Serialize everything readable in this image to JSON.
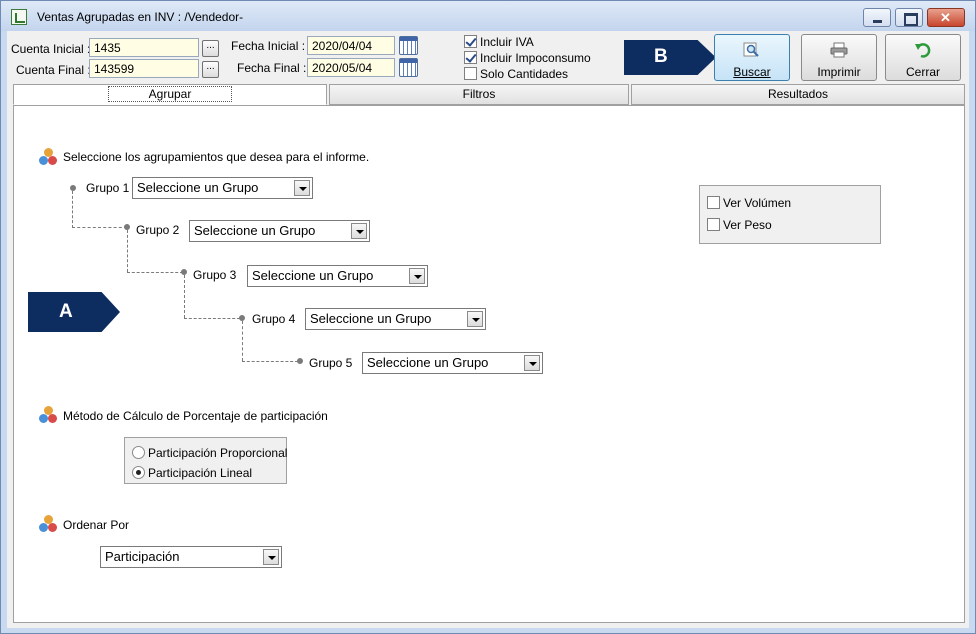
{
  "window": {
    "title": "Ventas Agrupadas en INV :  /Vendedor-"
  },
  "filters": {
    "cuenta_inicial_label": "Cuenta Inicial :",
    "cuenta_inicial_value": "1435",
    "cuenta_final_label": "Cuenta Final :",
    "cuenta_final_value": "143599",
    "fecha_inicial_label": "Fecha Inicial :",
    "fecha_inicial_value": "2020/04/04",
    "fecha_final_label": "Fecha Final :",
    "fecha_final_value": "2020/05/04",
    "dots_label": "...",
    "options": [
      {
        "label": "Incluir IVA",
        "checked": true
      },
      {
        "label": "Incluir Impoconsumo",
        "checked": true
      },
      {
        "label": "Solo Cantidades",
        "checked": false
      }
    ]
  },
  "toolbar": {
    "buscar_label": "Buscar",
    "imprimir_label": "Imprimir",
    "cerrar_label": "Cerrar"
  },
  "annotations": {
    "a": "A",
    "b": "B"
  },
  "tabs": [
    {
      "label": "Agrupar",
      "selected": true
    },
    {
      "label": "Filtros",
      "selected": false
    },
    {
      "label": "Resultados",
      "selected": false
    }
  ],
  "agrupar": {
    "intro": "Seleccione los agrupamientos que desea para el informe.",
    "groups": [
      {
        "label": "Grupo 1",
        "value": "Seleccione un Grupo"
      },
      {
        "label": "Grupo 2",
        "value": "Seleccione un Grupo"
      },
      {
        "label": "Grupo 3",
        "value": "Seleccione un Grupo"
      },
      {
        "label": "Grupo 4",
        "value": "Seleccione un Grupo"
      },
      {
        "label": "Grupo 5",
        "value": "Seleccione un Grupo"
      }
    ],
    "ver": [
      {
        "label": "Ver Volúmen",
        "checked": false
      },
      {
        "label": "Ver Peso",
        "checked": false
      }
    ],
    "metodo_title": "Método de Cálculo de Porcentaje de participación",
    "metodo_options": [
      {
        "label": "Participación Proporcional",
        "selected": false
      },
      {
        "label": "Participación Lineal",
        "selected": true
      }
    ],
    "ordenar_title": "Ordenar Por",
    "ordenar_value": "Participación"
  }
}
